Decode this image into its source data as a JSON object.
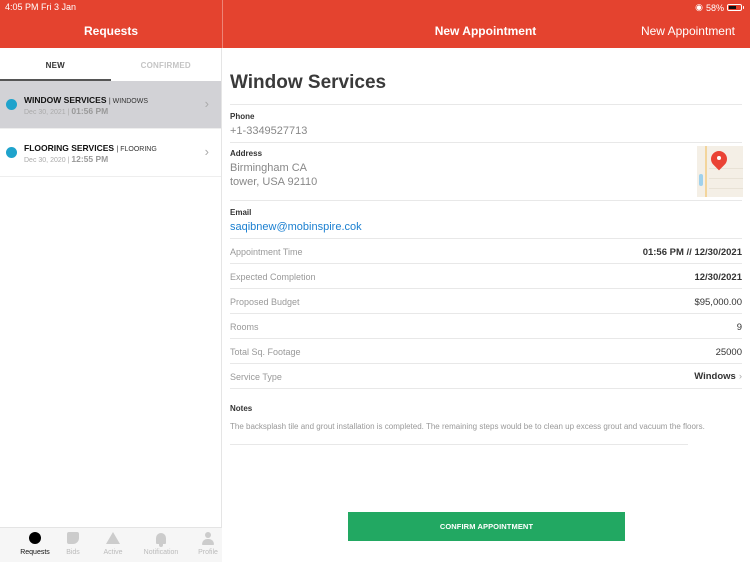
{
  "status_bar": {
    "time": "4:05 PM   Fri 3 Jan",
    "battery": "58%"
  },
  "header": {
    "left_title": "Requests",
    "center_title": "New Appointment",
    "right_action": "New Appointment",
    "color": "#e4432f"
  },
  "tabs": [
    {
      "label": "NEW",
      "active": true
    },
    {
      "label": "CONFIRMED",
      "active": false
    }
  ],
  "requests": [
    {
      "title": "WINDOW SERVICES",
      "category": "| WINDOWS",
      "date": "Dec 30, 2021 | ",
      "time": "01:56 PM",
      "selected": true
    },
    {
      "title": "FLOORING SERVICES",
      "category": "| FLOORING",
      "date": "Dec 30, 2020 | ",
      "time": "12:55 PM",
      "selected": false
    }
  ],
  "bottom_nav": [
    {
      "label": "Requests",
      "icon": "requests-icon",
      "active": true
    },
    {
      "label": "Bids",
      "icon": "bids-icon",
      "active": false
    },
    {
      "label": "Active",
      "icon": "active-icon",
      "active": false
    },
    {
      "label": "Notification",
      "icon": "bell-icon",
      "active": false
    },
    {
      "label": "Profile",
      "icon": "profile-icon",
      "active": false
    }
  ],
  "detail": {
    "title": "Window Services",
    "phone_label": "Phone",
    "phone": "+1-3349527713",
    "address_label": "Address",
    "address_line1": "Birmingham  CA",
    "address_line2": "tower, USA 92110",
    "email_label": "Email",
    "email": "saqibnew@mobinspire.cok",
    "rows": [
      {
        "label": "Appointment Time",
        "value": "01:56 PM // 12/30/2021",
        "bold": true
      },
      {
        "label": "Expected Completion",
        "value": "12/30/2021",
        "bold": true
      },
      {
        "label": "Proposed Budget",
        "value": "$95,000.00",
        "bold": false
      },
      {
        "label": "Rooms",
        "value": "9",
        "bold": false
      },
      {
        "label": "Total Sq. Footage",
        "value": "25000",
        "bold": false
      },
      {
        "label": "Service Type",
        "value": "Windows",
        "bold": true
      }
    ],
    "notes_label": "Notes",
    "notes": "The backsplash tile and grout installation is completed. The remaining steps would be to clean up excess grout and vacuum the floors.",
    "confirm_label": "CONFIRM APPOINTMENT",
    "confirm_color": "#22a862",
    "link_color": "#1a7fd0",
    "dot_color": "#1fa3cc"
  }
}
